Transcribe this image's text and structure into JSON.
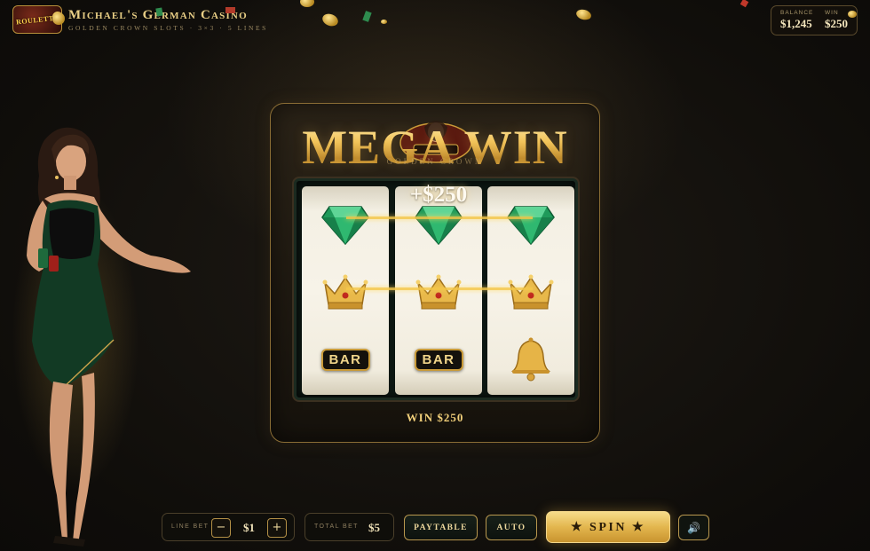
{
  "header": {
    "title": "Michael's German Casino",
    "subtitle": "GOLDEN CROWN SLOTS · 3×3 · 5 LINES",
    "logo_text": "ROULETTE"
  },
  "stats": {
    "balance_label": "BALANCE",
    "balance_value": "$1,245",
    "win_label": "WIN",
    "win_value": "$250"
  },
  "machine": {
    "banner": "MEGA WIN",
    "banner_sub": "GOLDEN CROWN",
    "win_popup": "+$250",
    "win_readout": "WIN $250",
    "reels": [
      [
        "emerald",
        "crown",
        "BAR"
      ],
      [
        "emerald",
        "crown",
        "BAR"
      ],
      [
        "emerald",
        "crown",
        "bell"
      ]
    ],
    "winning_rows": [
      "top",
      "middle"
    ]
  },
  "controls": {
    "line_bet_label": "LINE BET",
    "line_bet_value": "$1",
    "minus": "−",
    "plus": "+",
    "total_bet_label": "TOTAL BET",
    "total_bet_value": "$5",
    "paytable": "PAYTABLE",
    "auto": "AUTO",
    "spin": "★ SPIN ★",
    "sound": "🔊"
  },
  "colors": {
    "gold": "#e7b84a",
    "emerald": "#1f9a5a",
    "background": "#0f0d0a"
  }
}
